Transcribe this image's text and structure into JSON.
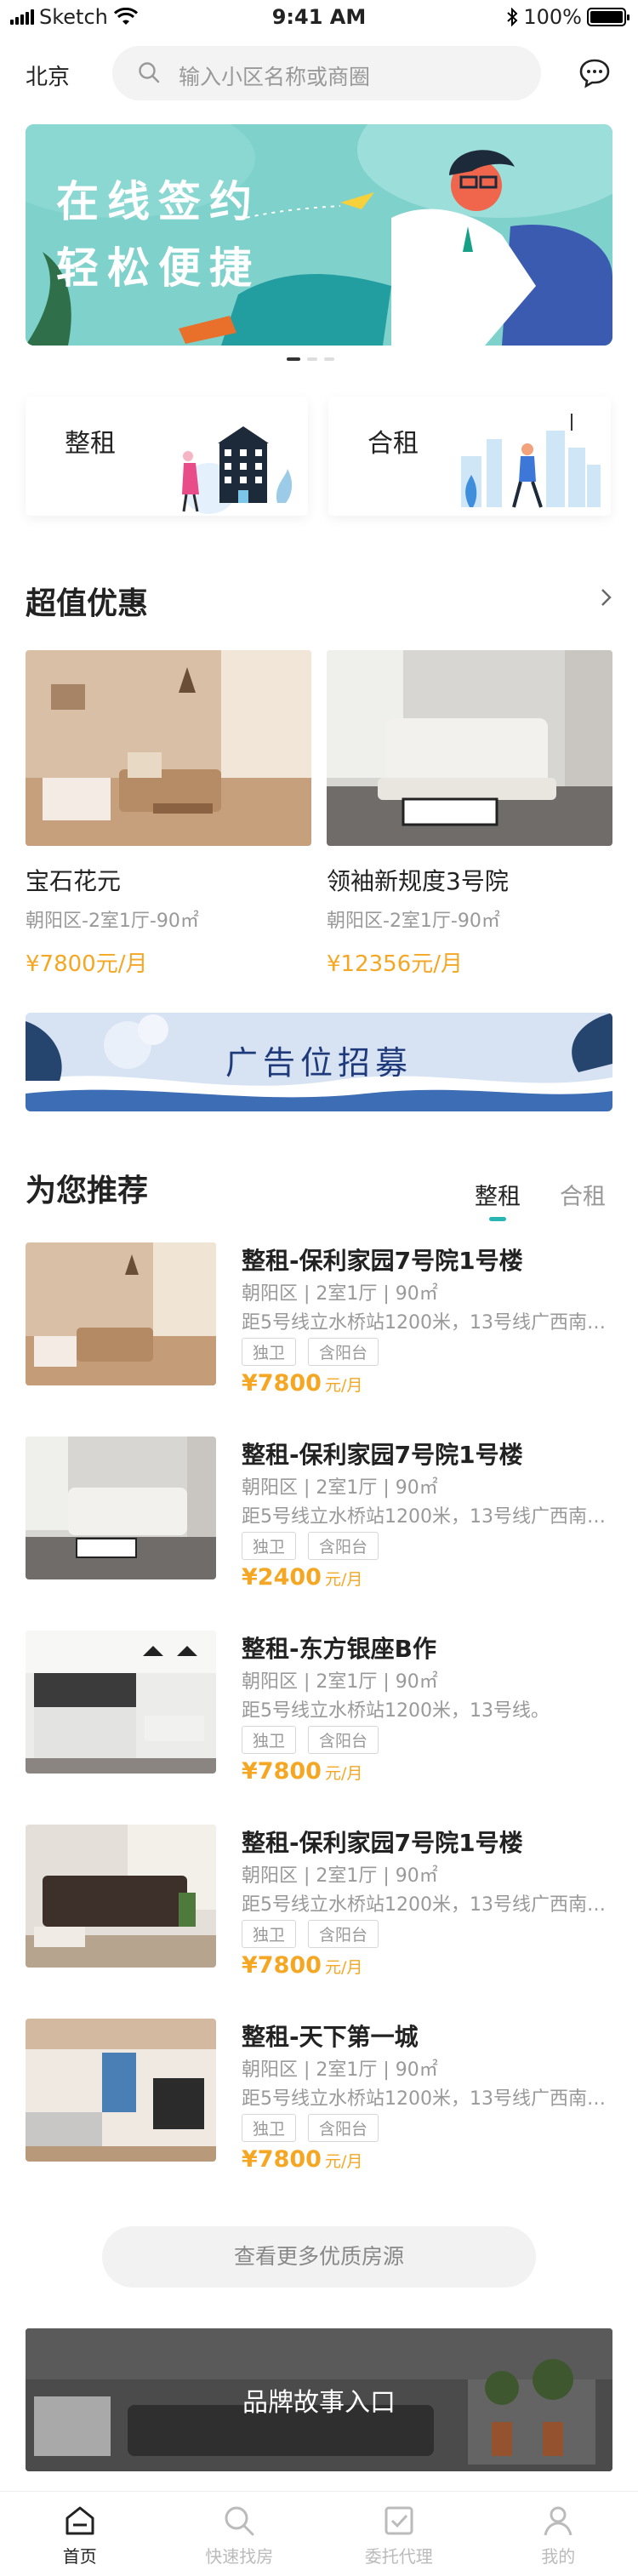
{
  "status_bar": {
    "carrier": "Sketch",
    "time": "9:41 AM",
    "battery": "100%",
    "battery_level": 1.0
  },
  "header": {
    "city": "北京",
    "search_placeholder": "输入小区名称或商圈"
  },
  "banner": {
    "line1": "在线签约",
    "line2": "轻松便捷",
    "slide_count": 3,
    "active_slide": 1
  },
  "rent_types": [
    {
      "label": "整租"
    },
    {
      "label": "合租"
    }
  ],
  "deals": {
    "title": "超值优惠",
    "items": [
      {
        "name": "宝石花元",
        "meta": "朝阳区-2室1厅-90㎡",
        "price": "¥7800元/月"
      },
      {
        "name": "领袖新规度3号院",
        "meta": "朝阳区-2室1厅-90㎡",
        "price": "¥12356元/月"
      }
    ]
  },
  "ad": {
    "text": "广告位招募"
  },
  "recommend": {
    "title": "为您推荐",
    "tabs": [
      {
        "label": "整租",
        "active": true
      },
      {
        "label": "合租",
        "active": false
      }
    ],
    "listings": [
      {
        "title": "整租-保利家园7号院1号楼",
        "meta": "朝阳区 | 2室1厅 | 90㎡",
        "distance": "距5号线立水桥站1200米，13号线广西南合...",
        "tags": [
          "独卫",
          "含阳台"
        ],
        "price": "¥7800",
        "unit": "元/月"
      },
      {
        "title": "整租-保利家园7号院1号楼",
        "meta": "朝阳区 | 2室1厅 | 90㎡",
        "distance": "距5号线立水桥站1200米，13号线广西南合...",
        "tags": [
          "独卫",
          "含阳台"
        ],
        "price": "¥2400",
        "unit": "元/月"
      },
      {
        "title": "整租-东方银座B作",
        "meta": "朝阳区 | 2室1厅 | 90㎡",
        "distance": "距5号线立水桥站1200米，13号线。",
        "tags": [
          "独卫",
          "含阳台"
        ],
        "price": "¥7800",
        "unit": "元/月"
      },
      {
        "title": "整租-保利家园7号院1号楼",
        "meta": "朝阳区 | 2室1厅 | 90㎡",
        "distance": "距5号线立水桥站1200米，13号线广西南合...",
        "tags": [
          "独卫",
          "含阳台"
        ],
        "price": "¥7800",
        "unit": "元/月"
      },
      {
        "title": "整租-天下第一城",
        "meta": "朝阳区 | 2室1厅 | 90㎡",
        "distance": "距5号线立水桥站1200米，13号线广西南合...",
        "tags": [
          "独卫",
          "含阳台"
        ],
        "price": "¥7800",
        "unit": "元/月"
      }
    ],
    "more_label": "查看更多优质房源"
  },
  "brand": {
    "text": "品牌故事入口"
  },
  "tabbar": [
    {
      "label": "首页",
      "icon": "home-icon",
      "active": true
    },
    {
      "label": "快速找房",
      "icon": "search-icon",
      "active": false
    },
    {
      "label": "委托代理",
      "icon": "check-icon",
      "active": false
    },
    {
      "label": "我的",
      "icon": "user-icon",
      "active": false
    }
  ],
  "colors": {
    "accent": "#27b6b4",
    "price": "#f5a623",
    "banner_bg": "#7fd1cc"
  }
}
